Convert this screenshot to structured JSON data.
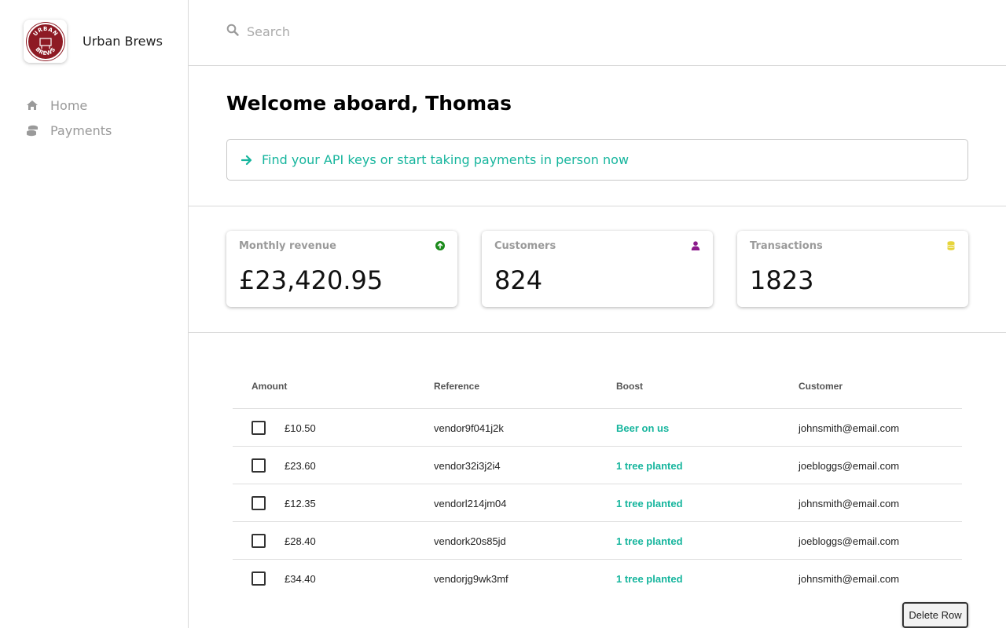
{
  "brand": {
    "name": "Urban Brews",
    "logo_text_top": "URBAN",
    "logo_text_bottom": "BREWS",
    "logo_color": "#8e1a24"
  },
  "sidebar": {
    "items": [
      {
        "label": "Home",
        "icon": "home-icon"
      },
      {
        "label": "Payments",
        "icon": "coins-icon"
      }
    ]
  },
  "search": {
    "placeholder": "Search",
    "value": ""
  },
  "welcome": {
    "title": "Welcome aboard, Thomas",
    "banner_text": "Find your API keys or start taking payments in person now",
    "accent_color": "#16b59d"
  },
  "stats": [
    {
      "label": "Monthly revenue",
      "value": "£23,420.95",
      "icon": "arrow-up-circle-icon",
      "icon_color": "#1a8a1a"
    },
    {
      "label": "Customers",
      "value": "824",
      "icon": "user-icon",
      "icon_color": "#8b1a8b"
    },
    {
      "label": "Transactions",
      "value": "1823",
      "icon": "database-icon",
      "icon_color": "#e6d43a"
    }
  ],
  "table": {
    "headers": {
      "amount": "Amount",
      "reference": "Reference",
      "boost": "Boost",
      "customer": "Customer"
    },
    "rows": [
      {
        "amount": "£10.50",
        "reference": "vendor9f041j2k",
        "boost": "Beer on us",
        "customer": "johnsmith@email.com"
      },
      {
        "amount": "£23.60",
        "reference": "vendor32i3j2i4",
        "boost": "1 tree planted",
        "customer": "joebloggs@email.com"
      },
      {
        "amount": "£12.35",
        "reference": "vendorl214jm04",
        "boost": "1 tree planted",
        "customer": "johnsmith@email.com"
      },
      {
        "amount": "£28.40",
        "reference": "vendork20s85jd",
        "boost": "1 tree planted",
        "customer": "joebloggs@email.com"
      },
      {
        "amount": "£34.40",
        "reference": "vendorjg9wk3mf",
        "boost": "1 tree planted",
        "customer": "johnsmith@email.com"
      }
    ]
  },
  "actions": {
    "delete_row_label": "Delete Row"
  }
}
